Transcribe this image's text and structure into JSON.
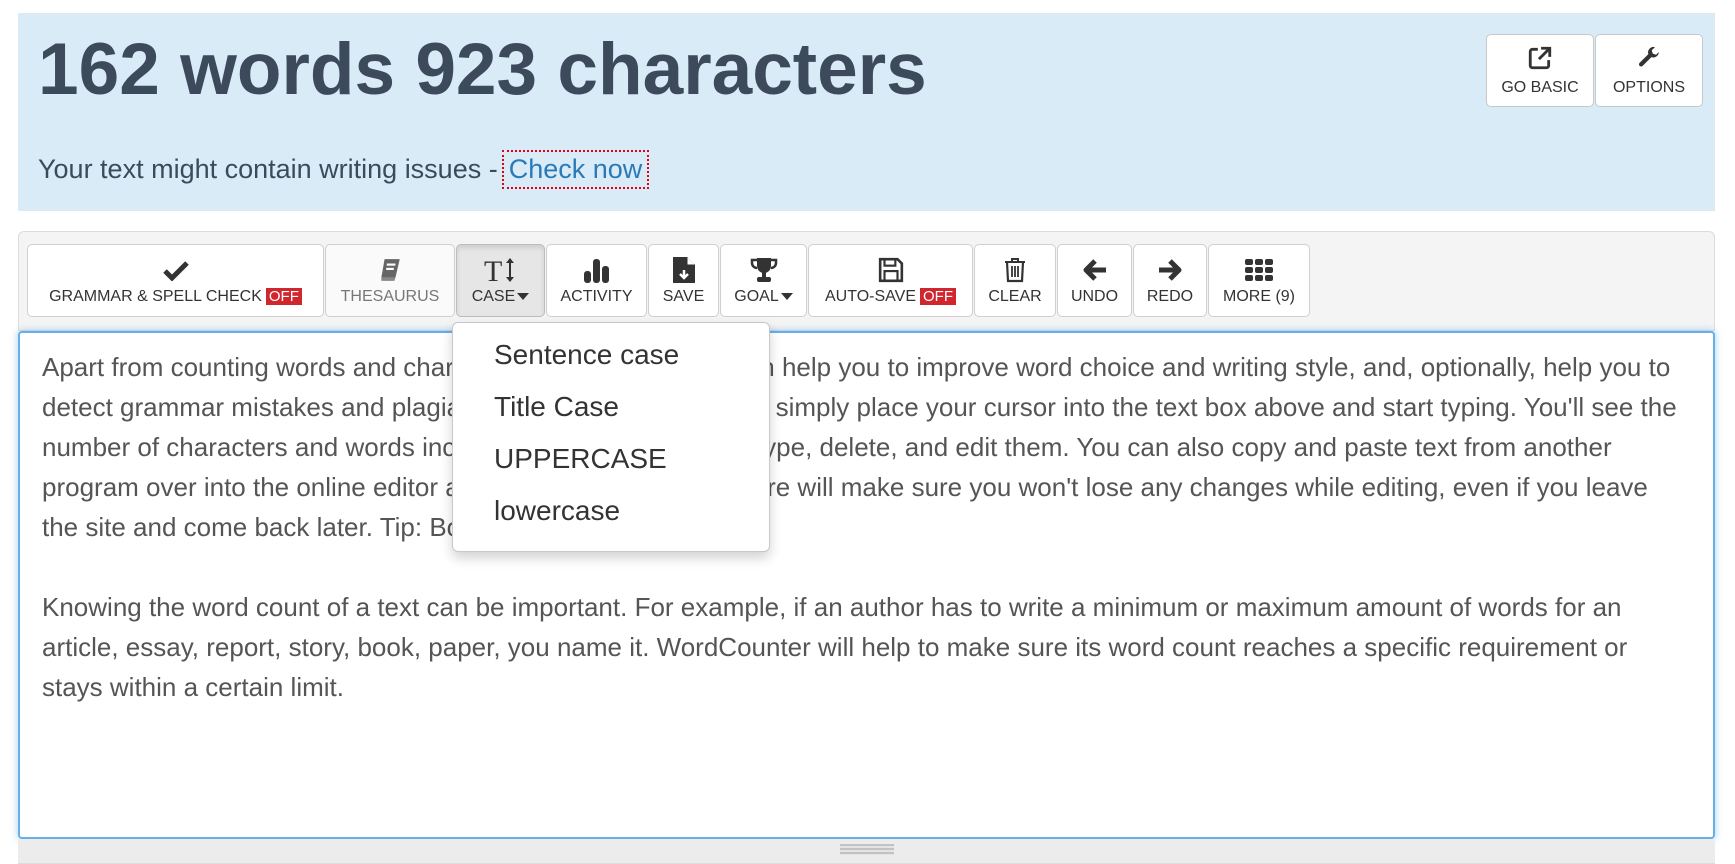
{
  "header": {
    "counts_title": "162 words 923 characters",
    "issues_text": "Your text might contain writing issues -",
    "check_now_link": "Check now",
    "go_basic_label": "GO BASIC",
    "options_label": "OPTIONS"
  },
  "toolbar": {
    "grammar_label": "GRAMMAR & SPELL CHECK",
    "grammar_state": "OFF",
    "thesaurus_label": "THESAURUS",
    "case_label": "CASE",
    "activity_label": "ACTIVITY",
    "save_label": "SAVE",
    "goal_label": "GOAL",
    "autosave_label": "AUTO-SAVE",
    "autosave_state": "OFF",
    "clear_label": "CLEAR",
    "undo_label": "UNDO",
    "redo_label": "REDO",
    "more_label": "MORE (9)"
  },
  "case_dropdown": {
    "items": [
      "Sentence case",
      "Title Case",
      "UPPERCASE",
      "lowercase"
    ]
  },
  "editor": {
    "paragraphs": [
      "Apart from counting words and characters, our online editor can help you to improve word choice and writing style, and, optionally, help you to detect grammar mistakes and plagiarism. To check word count, simply place your cursor into the text box above and start typing. You'll see the number of characters and words increase or decrease as you type, delete, and edit them. You can also copy and paste text from another program over into the online editor above. The Auto-Save feature will make sure you won't lose any changes while editing, even if you leave the site and come back later. Tip: Bookmark this page now.",
      "Knowing the word count of a text can be important. For example, if an author has to write a minimum or maximum amount of words for an article, essay, report, story, book, paper, you name it. WordCounter will help to make sure its word count reaches a specific requirement or stays within a certain limit."
    ]
  },
  "colors": {
    "header_bg": "#d9ebf7",
    "title_color": "#3d4a5c",
    "link_color": "#2a7ab8",
    "off_badge": "#d0262d",
    "editor_focus": "#66afe9"
  }
}
